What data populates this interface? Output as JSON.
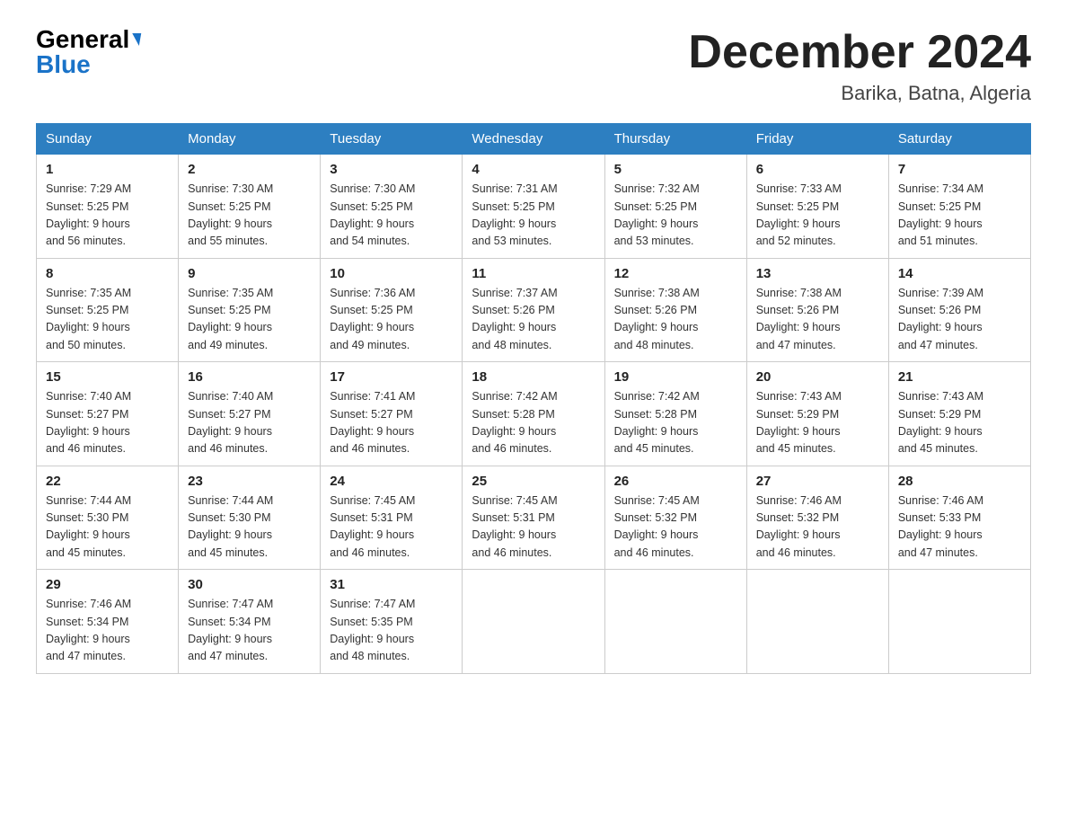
{
  "header": {
    "logo_general": "General",
    "logo_blue": "Blue",
    "month_year": "December 2024",
    "location": "Barika, Batna, Algeria"
  },
  "columns": [
    "Sunday",
    "Monday",
    "Tuesday",
    "Wednesday",
    "Thursday",
    "Friday",
    "Saturday"
  ],
  "weeks": [
    [
      {
        "day": "1",
        "sunrise": "7:29 AM",
        "sunset": "5:25 PM",
        "daylight": "9 hours and 56 minutes."
      },
      {
        "day": "2",
        "sunrise": "7:30 AM",
        "sunset": "5:25 PM",
        "daylight": "9 hours and 55 minutes."
      },
      {
        "day": "3",
        "sunrise": "7:30 AM",
        "sunset": "5:25 PM",
        "daylight": "9 hours and 54 minutes."
      },
      {
        "day": "4",
        "sunrise": "7:31 AM",
        "sunset": "5:25 PM",
        "daylight": "9 hours and 53 minutes."
      },
      {
        "day": "5",
        "sunrise": "7:32 AM",
        "sunset": "5:25 PM",
        "daylight": "9 hours and 53 minutes."
      },
      {
        "day": "6",
        "sunrise": "7:33 AM",
        "sunset": "5:25 PM",
        "daylight": "9 hours and 52 minutes."
      },
      {
        "day": "7",
        "sunrise": "7:34 AM",
        "sunset": "5:25 PM",
        "daylight": "9 hours and 51 minutes."
      }
    ],
    [
      {
        "day": "8",
        "sunrise": "7:35 AM",
        "sunset": "5:25 PM",
        "daylight": "9 hours and 50 minutes."
      },
      {
        "day": "9",
        "sunrise": "7:35 AM",
        "sunset": "5:25 PM",
        "daylight": "9 hours and 49 minutes."
      },
      {
        "day": "10",
        "sunrise": "7:36 AM",
        "sunset": "5:25 PM",
        "daylight": "9 hours and 49 minutes."
      },
      {
        "day": "11",
        "sunrise": "7:37 AM",
        "sunset": "5:26 PM",
        "daylight": "9 hours and 48 minutes."
      },
      {
        "day": "12",
        "sunrise": "7:38 AM",
        "sunset": "5:26 PM",
        "daylight": "9 hours and 48 minutes."
      },
      {
        "day": "13",
        "sunrise": "7:38 AM",
        "sunset": "5:26 PM",
        "daylight": "9 hours and 47 minutes."
      },
      {
        "day": "14",
        "sunrise": "7:39 AM",
        "sunset": "5:26 PM",
        "daylight": "9 hours and 47 minutes."
      }
    ],
    [
      {
        "day": "15",
        "sunrise": "7:40 AM",
        "sunset": "5:27 PM",
        "daylight": "9 hours and 46 minutes."
      },
      {
        "day": "16",
        "sunrise": "7:40 AM",
        "sunset": "5:27 PM",
        "daylight": "9 hours and 46 minutes."
      },
      {
        "day": "17",
        "sunrise": "7:41 AM",
        "sunset": "5:27 PM",
        "daylight": "9 hours and 46 minutes."
      },
      {
        "day": "18",
        "sunrise": "7:42 AM",
        "sunset": "5:28 PM",
        "daylight": "9 hours and 46 minutes."
      },
      {
        "day": "19",
        "sunrise": "7:42 AM",
        "sunset": "5:28 PM",
        "daylight": "9 hours and 45 minutes."
      },
      {
        "day": "20",
        "sunrise": "7:43 AM",
        "sunset": "5:29 PM",
        "daylight": "9 hours and 45 minutes."
      },
      {
        "day": "21",
        "sunrise": "7:43 AM",
        "sunset": "5:29 PM",
        "daylight": "9 hours and 45 minutes."
      }
    ],
    [
      {
        "day": "22",
        "sunrise": "7:44 AM",
        "sunset": "5:30 PM",
        "daylight": "9 hours and 45 minutes."
      },
      {
        "day": "23",
        "sunrise": "7:44 AM",
        "sunset": "5:30 PM",
        "daylight": "9 hours and 45 minutes."
      },
      {
        "day": "24",
        "sunrise": "7:45 AM",
        "sunset": "5:31 PM",
        "daylight": "9 hours and 46 minutes."
      },
      {
        "day": "25",
        "sunrise": "7:45 AM",
        "sunset": "5:31 PM",
        "daylight": "9 hours and 46 minutes."
      },
      {
        "day": "26",
        "sunrise": "7:45 AM",
        "sunset": "5:32 PM",
        "daylight": "9 hours and 46 minutes."
      },
      {
        "day": "27",
        "sunrise": "7:46 AM",
        "sunset": "5:32 PM",
        "daylight": "9 hours and 46 minutes."
      },
      {
        "day": "28",
        "sunrise": "7:46 AM",
        "sunset": "5:33 PM",
        "daylight": "9 hours and 47 minutes."
      }
    ],
    [
      {
        "day": "29",
        "sunrise": "7:46 AM",
        "sunset": "5:34 PM",
        "daylight": "9 hours and 47 minutes."
      },
      {
        "day": "30",
        "sunrise": "7:47 AM",
        "sunset": "5:34 PM",
        "daylight": "9 hours and 47 minutes."
      },
      {
        "day": "31",
        "sunrise": "7:47 AM",
        "sunset": "5:35 PM",
        "daylight": "9 hours and 48 minutes."
      },
      null,
      null,
      null,
      null
    ]
  ],
  "labels": {
    "sunrise": "Sunrise:",
    "sunset": "Sunset:",
    "daylight": "Daylight:"
  }
}
